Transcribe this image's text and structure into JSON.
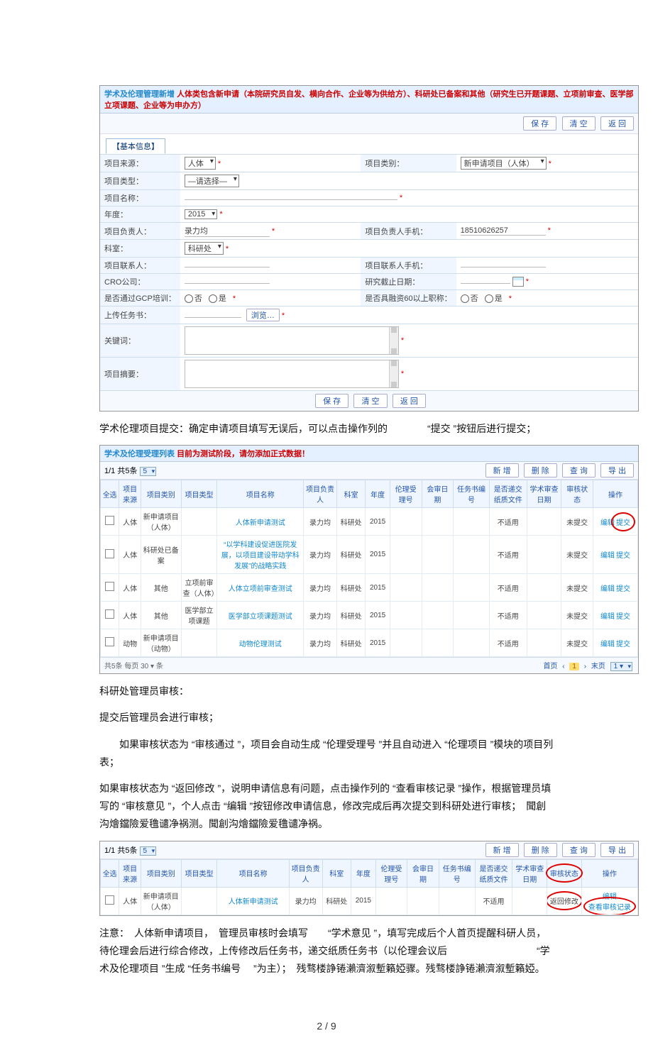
{
  "form": {
    "header_blue": "学术及伦理管理新增",
    "header_red": "人体类包含新申请（本院研究员自发、横向合作、企业等为供给方）、科研处已备案和其他（研究生已开题课题、立项前审查、医学部立项课题、企业等为申办方）",
    "buttons": {
      "save": "保 存",
      "clear": "清 空",
      "back": "返 回"
    },
    "tab": "【基本信息】",
    "labels": {
      "source": "项目来源：",
      "category": "项目类别：",
      "type": "项目类型：",
      "name": "项目名称：",
      "year": "年度：",
      "leader": "项目负责人：",
      "leader_phone": "项目负责人手机：",
      "dept": "科室：",
      "contact": "项目联系人：",
      "contact_phone": "项目联系人手机：",
      "cro": "CRO公司：",
      "deadline": "研究截止日期：",
      "gcp": "是否通过GCP培训：",
      "funding": "是否具融资60以上职称：",
      "upload": "上传任务书：",
      "keywords": "关键词：",
      "abstract": "项目摘要："
    },
    "values": {
      "source": "人体",
      "category": "新申请项目（人体）",
      "type": "—请选择—",
      "year": "2015",
      "leader": "录力均",
      "leader_phone": "18510626257",
      "dept": "科研处",
      "browse": "浏览…"
    },
    "radio": {
      "no": "否",
      "yes": "是"
    },
    "footer": {
      "save": "保 存",
      "clear": "清 空",
      "back": "返 回"
    }
  },
  "text1": "学术伦理项目提交：确定申请项目填写无误后，可以点击操作列的　　　　“提交 ”按钮后进行提交；",
  "list1": {
    "header_blue": "学术及伦理受理列表",
    "header_red": "目前为测试阶段，请勿添加正式数据！",
    "pager": "1/1 共5条",
    "buttons": {
      "new": "新 增",
      "del": "删 除",
      "query": "查 询",
      "export": "导 出"
    },
    "headers": [
      "全选",
      "项目来源",
      "项目类别",
      "项目类型",
      "项目名称",
      "项目负责人",
      "科室",
      "年度",
      "伦理受理号",
      "会审日期",
      "任务书编号",
      "是否递交纸质文件",
      "学术审查日期",
      "审核状态",
      "操作"
    ],
    "rows": [
      {
        "src": "人体",
        "cat": "新申请项目（人体）",
        "type": "",
        "name": "人体新申请测试",
        "leader": "录力均",
        "dept": "科研处",
        "year": "2015",
        "paper": "不适用",
        "status": "未提交",
        "op": [
          "编辑",
          "提交"
        ],
        "circle_op": 1
      },
      {
        "src": "人体",
        "cat": "科研处已备案",
        "type": "",
        "name": "“以学科建设促进医院发展，以项目建设带动学科发展”的战略实践",
        "leader": "录力均",
        "dept": "科研处",
        "year": "2015",
        "paper": "不适用",
        "status": "未提交",
        "op": [
          "编辑",
          "提交"
        ]
      },
      {
        "src": "人体",
        "cat": "其他",
        "type": "立项前审查（人体）",
        "name": "人体立项前审查测试",
        "leader": "录力均",
        "dept": "科研处",
        "year": "2015",
        "paper": "不适用",
        "status": "未提交",
        "op": [
          "编辑",
          "提交"
        ]
      },
      {
        "src": "人体",
        "cat": "其他",
        "type": "医学部立项课题",
        "name": "医学部立项课题测试",
        "leader": "录力均",
        "dept": "科研处",
        "year": "2015",
        "paper": "不适用",
        "status": "未提交",
        "op": [
          "编辑",
          "提交"
        ]
      },
      {
        "src": "动物",
        "cat": "新申请项目（动物）",
        "type": "",
        "name": "动物伦理测试",
        "leader": "录力均",
        "dept": "科研处",
        "year": "2015",
        "paper": "不适用",
        "status": "未提交",
        "op": [
          "编辑",
          "提交"
        ]
      }
    ],
    "foot_left": "共5条 每页 30 ▾ 条",
    "foot_right": [
      "首页",
      "‹",
      "1",
      "›",
      "末页",
      "1 ▾"
    ]
  },
  "text2a": "科研处管理员审核：",
  "text2b": "提交后管理员会进行审核；",
  "text2c": "　　如果审核状态为 “审核通过 ”，项目会自动生成 “伦理受理号 ”并且自动进入 “伦理项目 ”模块的项目列表；",
  "text2d": "如果审核状态为 “返回修改 ”，说明申请信息有问题，点击操作列的 “查看审核记录 ”操作，根据管理员填写的 “审核意见 ”，个人点击 “编辑 ”按钮修改申请信息，修改完成后再次提交到科研处进行审核；　聞創沟燴鐺險爱氇谴净祸测。聞創沟燴鐺險爱氇谴净祸。",
  "list2": {
    "pager": "1/1 共5条",
    "buttons": {
      "new": "新 增",
      "del": "删 除",
      "query": "查 询",
      "export": "导 出"
    },
    "headers": [
      "全选",
      "项目来源",
      "项目类别",
      "项目类型",
      "项目名称",
      "项目负责人",
      "科室",
      "年度",
      "伦理受理号",
      "会审日期",
      "任务书编号",
      "是否递交纸质文件",
      "学术审查日期",
      "审核状态",
      "操作"
    ],
    "row": {
      "src": "人体",
      "cat": "新申请项目（人体）",
      "type": "",
      "name": "人体新申请测试",
      "leader": "录力均",
      "dept": "科研处",
      "year": "2015",
      "paper": "不适用",
      "status": "返回修改",
      "op": [
        "编辑",
        "查看审核记录"
      ]
    }
  },
  "text3": "注意：　人体新申请项目，　管理员审核时会填写　　“学术意见 ”，填写完成后个人首页提醒科研人员，待伦理会后进行综合修改，上传修改后任务书，递交纸质任务书（以伦理会议后　　　　　　　　　“学术及伦理项目 ”生成 “任务书编号　 ”为主）；　残骛楼諍锩瀨濟溆塹籟婭骤。残骛楼諍锩瀨濟溆塹籟婭。",
  "page_no": "2 / 9"
}
